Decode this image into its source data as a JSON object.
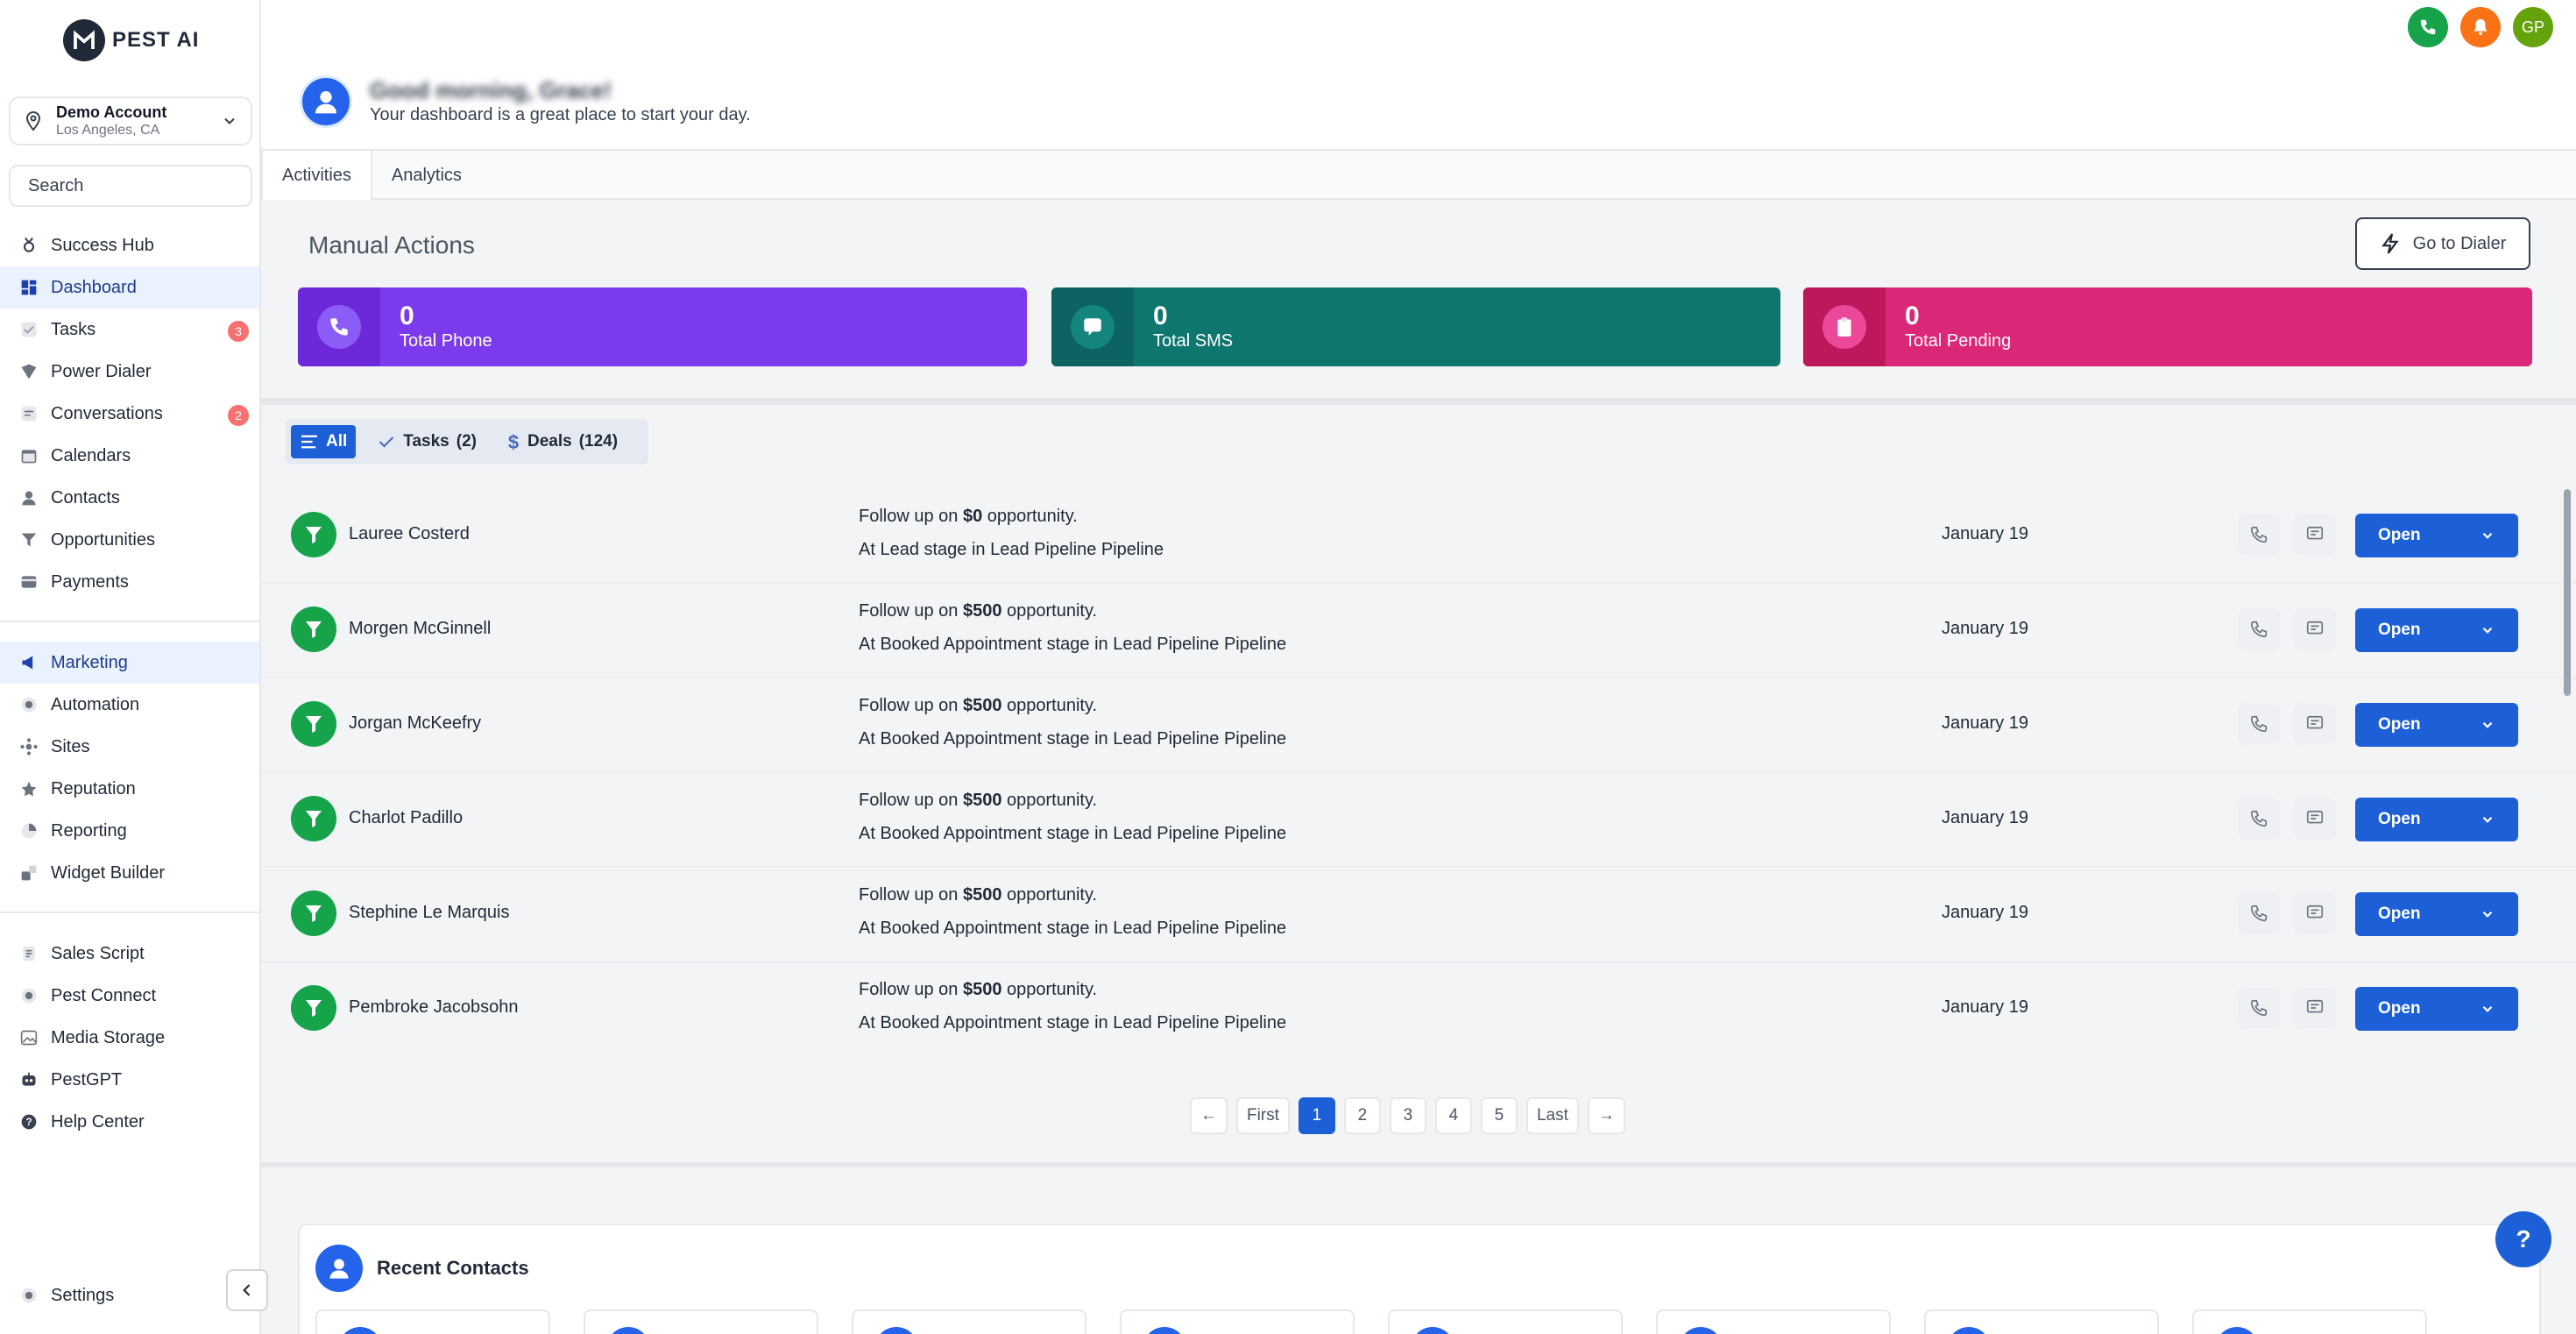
{
  "app": {
    "logo_text": "PEST AI"
  },
  "account": {
    "name": "Demo Account",
    "location": "Los Angeles, CA"
  },
  "search": {
    "placeholder": "Search"
  },
  "sidebar": {
    "items": [
      {
        "label": "Success Hub",
        "icon": "trophy-icon"
      },
      {
        "label": "Dashboard",
        "icon": "dashboard-icon",
        "active": true
      },
      {
        "label": "Tasks",
        "icon": "check-icon",
        "badge": "3"
      },
      {
        "label": "Power Dialer",
        "icon": "dialer-icon"
      },
      {
        "label": "Conversations",
        "icon": "chat-icon",
        "badge": "2"
      },
      {
        "label": "Calendars",
        "icon": "calendar-icon"
      },
      {
        "label": "Contacts",
        "icon": "person-icon"
      },
      {
        "label": "Opportunities",
        "icon": "funnel-icon"
      },
      {
        "label": "Payments",
        "icon": "card-icon"
      }
    ],
    "marketing_items": [
      {
        "label": "Marketing",
        "icon": "megaphone-icon",
        "active": true
      },
      {
        "label": "Automation",
        "icon": "automation-icon"
      },
      {
        "label": "Sites",
        "icon": "sites-icon"
      },
      {
        "label": "Reputation",
        "icon": "star-icon"
      },
      {
        "label": "Reporting",
        "icon": "chart-icon"
      },
      {
        "label": "Widget Builder",
        "icon": "widget-icon"
      }
    ],
    "tools_items": [
      {
        "label": "Sales Script",
        "icon": "script-icon"
      },
      {
        "label": "Pest Connect",
        "icon": "connect-icon"
      },
      {
        "label": "Media Storage",
        "icon": "image-icon"
      },
      {
        "label": "PestGPT",
        "icon": "robot-icon"
      },
      {
        "label": "Help Center",
        "icon": "help-icon"
      }
    ],
    "settings_label": "Settings"
  },
  "header": {
    "avatar_initials": "GP",
    "greeting": "Good morning, Grace!",
    "subtitle": "Your dashboard is a great place to start your day."
  },
  "tabs": [
    {
      "label": "Activities",
      "active": true
    },
    {
      "label": "Analytics"
    }
  ],
  "manual_actions": {
    "title": "Manual Actions",
    "dialer_button": "Go to Dialer",
    "stats": [
      {
        "value": "0",
        "label": "Total Phone",
        "color": "#7c3aed",
        "icon_bg": "#6d28d9"
      },
      {
        "value": "0",
        "label": "Total SMS",
        "color": "#0f766e",
        "icon_bg": "#0d6361"
      },
      {
        "value": "0",
        "label": "Total Pending",
        "color": "#db2777",
        "icon_bg": "#be185d"
      }
    ]
  },
  "filters": [
    {
      "label": "All",
      "active": true
    },
    {
      "label": "Tasks",
      "count": "(2)"
    },
    {
      "label": "Deals",
      "count": "(124)"
    }
  ],
  "rows": [
    {
      "name": "Lauree Costerd",
      "prefix": "Follow up on ",
      "amount": "$0",
      "suffix": " opportunity.",
      "stage": "At Lead stage in Lead Pipeline Pipeline",
      "date": "January 19",
      "action": "Open"
    },
    {
      "name": "Morgen McGinnell",
      "prefix": "Follow up on ",
      "amount": "$500",
      "suffix": " opportunity.",
      "stage": "At Booked Appointment stage in Lead Pipeline Pipeline",
      "date": "January 19",
      "action": "Open"
    },
    {
      "name": "Jorgan McKeefry",
      "prefix": "Follow up on ",
      "amount": "$500",
      "suffix": " opportunity.",
      "stage": "At Booked Appointment stage in Lead Pipeline Pipeline",
      "date": "January 19",
      "action": "Open"
    },
    {
      "name": "Charlot Padillo",
      "prefix": "Follow up on ",
      "amount": "$500",
      "suffix": " opportunity.",
      "stage": "At Booked Appointment stage in Lead Pipeline Pipeline",
      "date": "January 19",
      "action": "Open"
    },
    {
      "name": "Stephine Le Marquis",
      "prefix": "Follow up on ",
      "amount": "$500",
      "suffix": " opportunity.",
      "stage": "At Booked Appointment stage in Lead Pipeline Pipeline",
      "date": "January 19",
      "action": "Open"
    },
    {
      "name": "Pembroke Jacobsohn",
      "prefix": "Follow up on ",
      "amount": "$500",
      "suffix": " opportunity.",
      "stage": "At Booked Appointment stage in Lead Pipeline Pipeline",
      "date": "January 19",
      "action": "Open"
    }
  ],
  "pagination": {
    "prev": "←",
    "first": "First",
    "pages": [
      "1",
      "2",
      "3",
      "4",
      "5"
    ],
    "current": "1",
    "last": "Last",
    "next": "→"
  },
  "recent_contacts": {
    "title": "Recent Contacts"
  },
  "help_button": "?",
  "colors": {
    "primary": "#1d5fd6",
    "success": "#16a34a",
    "phone_green": "#16a34a",
    "bell_orange": "#f97316",
    "avatar_green": "#65a30d"
  }
}
